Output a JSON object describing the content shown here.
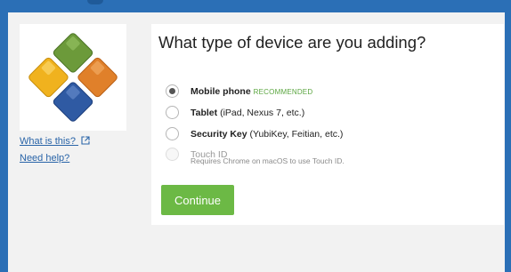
{
  "sidebar": {
    "what_is_this": "What is this?",
    "need_help": "Need help?"
  },
  "prompt": {
    "title": "What type of device are you adding?"
  },
  "options": [
    {
      "label": "Mobile phone",
      "detail": "",
      "badge": "RECOMMENDED",
      "selected": true,
      "disabled": false
    },
    {
      "label": "Tablet",
      "detail": " (iPad, Nexus 7, etc.)",
      "badge": "",
      "selected": false,
      "disabled": false
    },
    {
      "label": "Security Key",
      "detail": " (YubiKey, Feitian, etc.)",
      "badge": "",
      "selected": false,
      "disabled": false
    },
    {
      "label": "Touch ID",
      "detail": "",
      "badge": "",
      "selected": false,
      "disabled": true
    }
  ],
  "touch_id_note": "Requires Chrome on macOS to use Touch ID.",
  "continue_label": "Continue",
  "icons": {
    "external_link": "external-link-icon"
  },
  "colors": {
    "frame_blue": "#2b6fb6",
    "link_blue": "#2964a8",
    "accent_green": "#6cb945",
    "recommended_green": "#5aa53f"
  }
}
